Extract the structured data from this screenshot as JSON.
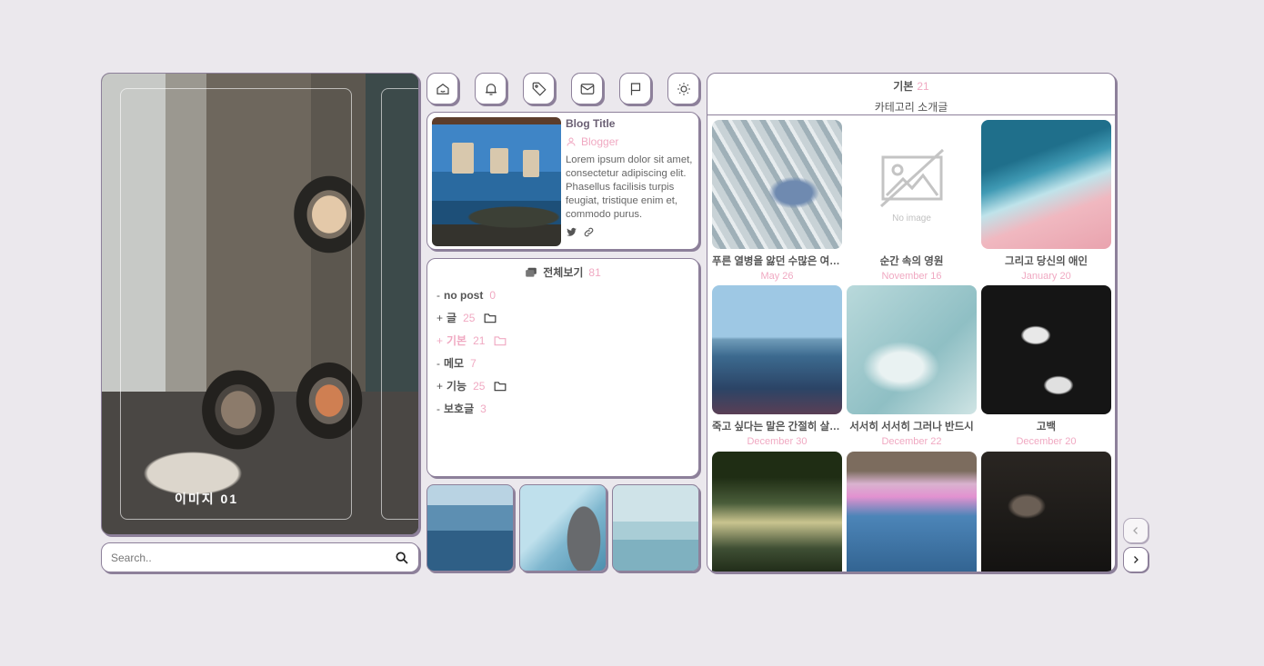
{
  "hero": {
    "caption": "이미지 01"
  },
  "search": {
    "placeholder": "Search.."
  },
  "toolbar": {
    "icons": [
      "home-icon",
      "bell-icon",
      "tag-icon",
      "mail-icon",
      "flag-icon",
      "sun-icon"
    ]
  },
  "profile": {
    "title": "Blog Title",
    "author": "Blogger",
    "description": "Lorem ipsum dolor sit amet, consectetur adipiscing elit. Phasellus facilisis turpis feugiat, tristique enim et, commodo purus."
  },
  "categories": {
    "all_label": "전체보기",
    "all_count": "81",
    "items": [
      {
        "prefix": "-",
        "name": "no post",
        "count": "0",
        "folder": false,
        "active": false
      },
      {
        "prefix": "+",
        "name": "글",
        "count": "25",
        "folder": true,
        "active": false
      },
      {
        "prefix": "+",
        "name": "기본",
        "count": "21",
        "folder": true,
        "active": true
      },
      {
        "prefix": "-",
        "name": "메모",
        "count": "7",
        "folder": false,
        "active": false
      },
      {
        "prefix": "+",
        "name": "기능",
        "count": "25",
        "folder": true,
        "active": false
      },
      {
        "prefix": "-",
        "name": "보호글",
        "count": "3",
        "folder": false,
        "active": false
      }
    ]
  },
  "posts": {
    "category_name": "기본",
    "category_count": "21",
    "category_desc": "카테고리 소개글",
    "no_image_label": "No image",
    "items": [
      {
        "title": "푸른 열병을 앓던 수많은 여름들",
        "date": "May 26"
      },
      {
        "title": "순간 속의 영원",
        "date": "November 16"
      },
      {
        "title": "그리고 당신의 애인",
        "date": "January 20"
      },
      {
        "title": "죽고 싶다는 말은 간절히 살고 싶다는 말",
        "date": "December 30"
      },
      {
        "title": "서서히 서서히 그러나 반드시",
        "date": "December 22"
      },
      {
        "title": "고백",
        "date": "December 20"
      },
      {
        "title": "",
        "date": ""
      },
      {
        "title": "",
        "date": ""
      },
      {
        "title": "",
        "date": ""
      }
    ]
  },
  "colors": {
    "accent": "#f0a9c2",
    "border": "#8d809a",
    "background": "#ebe8ed"
  }
}
